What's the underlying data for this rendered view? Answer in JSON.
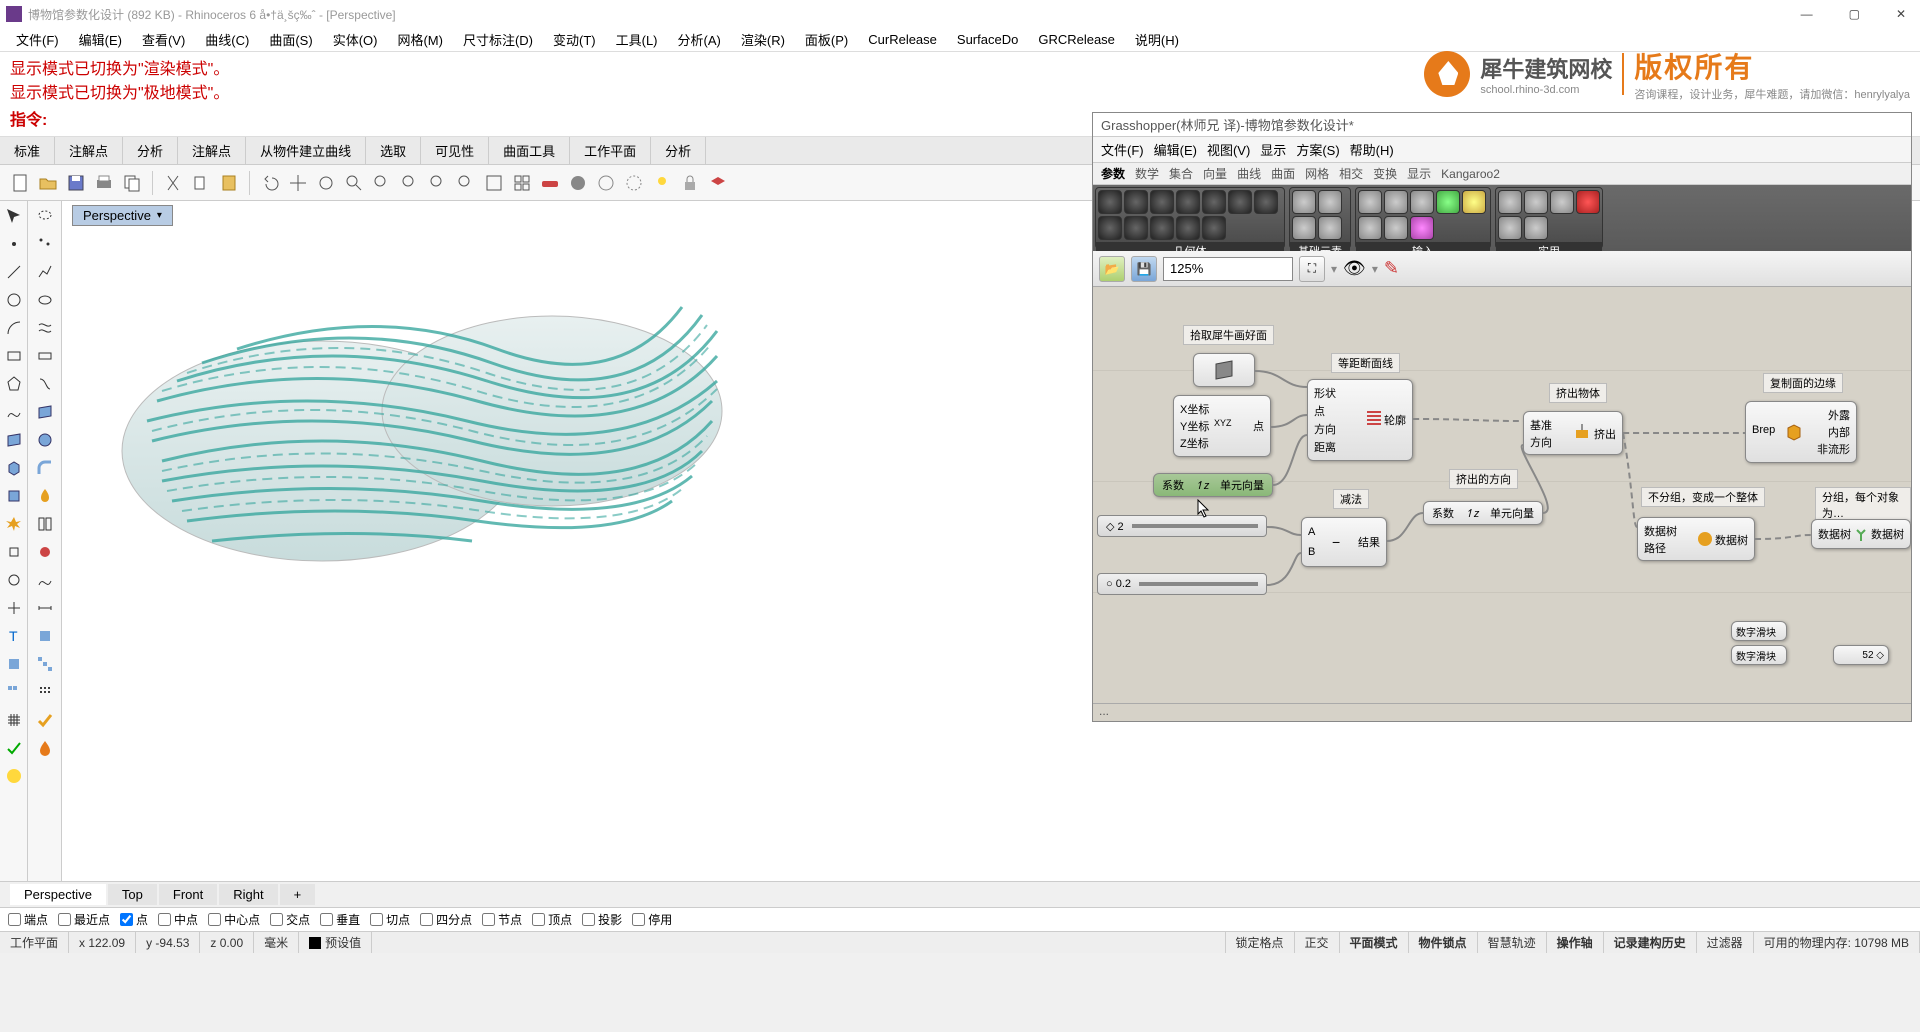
{
  "window": {
    "title": "博物馆参数化设计 (892 KB) - Rhinoceros 6 å•†ä¸šç‰ˆ - [Perspective]",
    "min": "—",
    "max": "▢",
    "close": "✕"
  },
  "menubar": [
    "文件(F)",
    "编辑(E)",
    "查看(V)",
    "曲线(C)",
    "曲面(S)",
    "实体(O)",
    "网格(M)",
    "尺寸标注(D)",
    "变动(T)",
    "工具(L)",
    "分析(A)",
    "渲染(R)",
    "面板(P)",
    "CurRelease",
    "SurfaceDo",
    "GRCRelease",
    "说明(H)"
  ],
  "cmd": {
    "line1": "显示模式已切换为\"渲染模式\"。",
    "line2": "显示模式已切换为\"极地模式\"。",
    "prompt": "指令:"
  },
  "tabs": [
    "标准",
    "注解点",
    "分析",
    "注解点",
    "从物件建立曲线",
    "选取",
    "可见性",
    "曲面工具",
    "工作平面",
    "分析"
  ],
  "viewport": {
    "label": "Perspective",
    "drop": "▾"
  },
  "gh": {
    "title": "Grasshopper(林师兄 译)-博物馆参数化设计*",
    "menu": [
      "文件(F)",
      "编辑(E)",
      "视图(V)",
      "显示",
      "方案(S)",
      "帮助(H)"
    ],
    "tabs": [
      "参数",
      "数学",
      "集合",
      "向量",
      "曲线",
      "曲面",
      "网格",
      "相交",
      "变换",
      "显示",
      "Kangaroo2"
    ],
    "groups": [
      "几何体",
      "基础元素",
      "输入",
      "实用"
    ],
    "zoom": "125%",
    "status": "...",
    "captions": {
      "c1": "拾取犀牛画好面",
      "c2": "等距断面线",
      "c3": "挤出物体",
      "c4": "复制面的边缘",
      "c5": "挤出的方向",
      "c6": "减法",
      "c7": "不分组，变成一个整体",
      "c8": "分组，每个对象为…"
    },
    "nodes": {
      "xyz_x": "X坐标",
      "xyz_y": "Y坐标",
      "xyz_z": "Z坐标",
      "xyz_pt": "点",
      "xyz_mid": "XYZ",
      "unitvec_a": "系数",
      "unitvec_b": "单元向量",
      "sec_shape": "形状",
      "sec_pt": "点",
      "sec_dir": "方向",
      "sec_dist": "距离",
      "sec_out": "轮廓",
      "sub_a": "A",
      "sub_b": "B",
      "sub_out": "结果",
      "unitvec2_a": "系数",
      "unitvec2_b": "单元向量",
      "ext_base": "基准",
      "ext_dir": "方向",
      "ext_out": "挤出",
      "brep": "Brep",
      "brep_a": "外露",
      "brep_b": "内部",
      "brep_c": "非流形",
      "tree1_a": "数据树",
      "tree1_b": "路径",
      "tree1_out": "数据树",
      "tree2_a": "数据树",
      "tree2_out": "数据树",
      "numsl": "数字滑块",
      "numsl2": "数字滑块",
      "numsl2_val": "52 ◇"
    },
    "sliders": {
      "s1": "◇ 2",
      "s2": "○ 0.2"
    }
  },
  "viewtabs": [
    "Perspective",
    "Top",
    "Front",
    "Right",
    "+"
  ],
  "osnap": [
    {
      "label": "端点",
      "checked": false
    },
    {
      "label": "最近点",
      "checked": false
    },
    {
      "label": "点",
      "checked": true
    },
    {
      "label": "中点",
      "checked": false
    },
    {
      "label": "中心点",
      "checked": false
    },
    {
      "label": "交点",
      "checked": false
    },
    {
      "label": "垂直",
      "checked": false
    },
    {
      "label": "切点",
      "checked": false
    },
    {
      "label": "四分点",
      "checked": false
    },
    {
      "label": "节点",
      "checked": false
    },
    {
      "label": "顶点",
      "checked": false
    },
    {
      "label": "投影",
      "checked": false
    },
    {
      "label": "停用",
      "checked": false
    }
  ],
  "statusbar": {
    "plane": "工作平面",
    "x": "x 122.09",
    "y": "y -94.53",
    "z": "z 0.00",
    "unit": "毫米",
    "layer": "预设值",
    "s1": "锁定格点",
    "s2": "正交",
    "s3": "平面模式",
    "s4": "物件锁点",
    "s5": "智慧轨迹",
    "s6": "操作轴",
    "s7": "记录建构历史",
    "s8": "过滤器",
    "mem": "可用的物理内存: 10798 MB"
  },
  "watermark": {
    "t1": "犀牛建筑网校",
    "s1": "school.rhino-3d.com",
    "t2": "版权所有",
    "s2": "咨询课程，设计业务，犀牛难题，请加微信：henrylyalya"
  }
}
